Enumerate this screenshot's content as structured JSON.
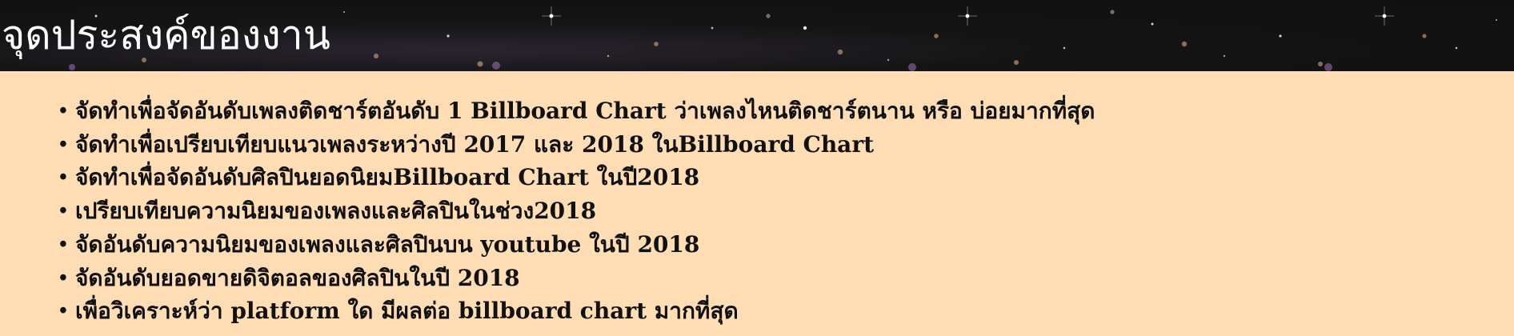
{
  "header": {
    "title": "จุดประสงค์ของงาน"
  },
  "goals": [
    "จัดทำเพื่อจัดอันดับเพลงติดชาร์ตอันดับ 1 Billboard Chart ว่าเพลงไหนติดชาร์ตนาน หรือ บ่อยมากที่สุด",
    "จัดทำเพื่อเปรียบเทียบแนวเพลงระหว่างปี 2017 และ 2018 ในBillboard Chart",
    "จัดทำเพื่อจัดอันดับศิลปินยอดนิยมBillboard Chart ในปี2018",
    "เปรียบเทียบความนิยมของเพลงและศิลปินในช่วง2018",
    "จัดอันดับความนิยมของเพลงและศิลปินบน youtube ในปี 2018",
    "จัดอันดับยอดขายดิจิตอลของศิลปินในปี 2018",
    "เพื่อวิเคราะห์ว่า platform ใด มีผลต่อ billboard chart มากที่สุด"
  ],
  "bullet": "•",
  "colors": {
    "background": "#ffddb5",
    "header_bg": "#121212",
    "title_text": "#ffffff",
    "body_text": "#111111"
  }
}
